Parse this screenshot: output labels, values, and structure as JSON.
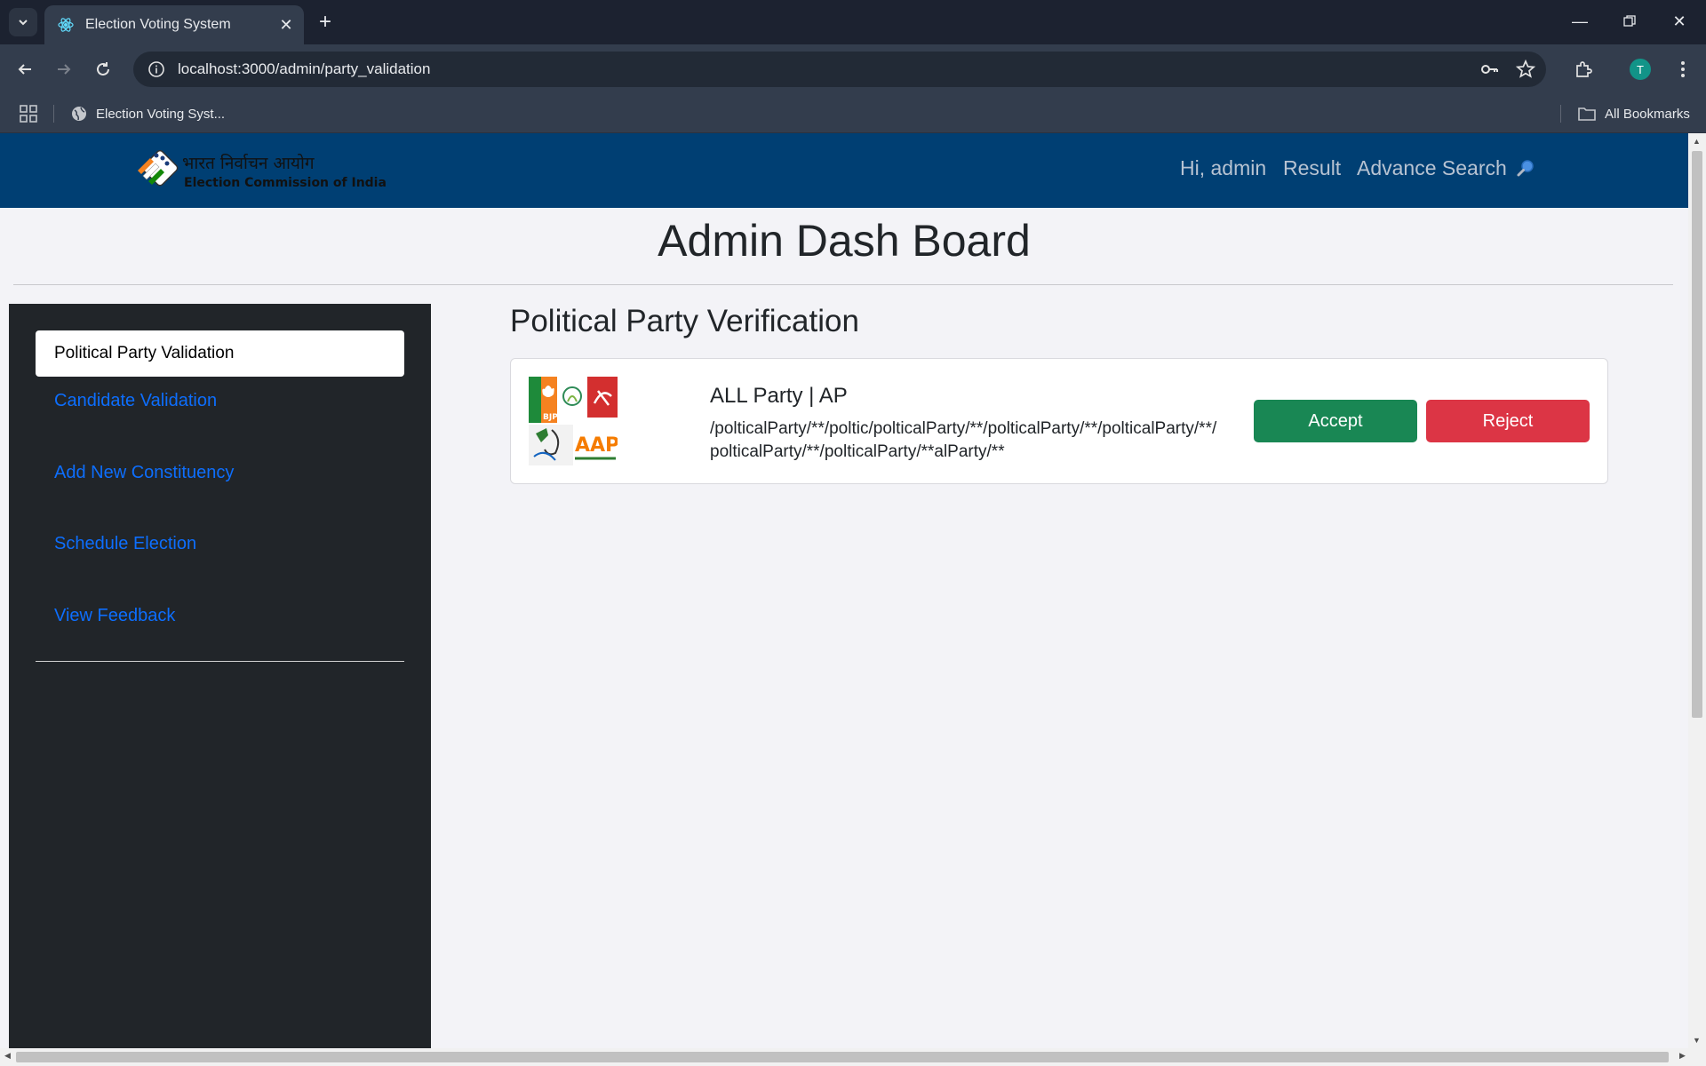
{
  "browser": {
    "tab_title": "Election Voting System",
    "url": "localhost:3000/admin/party_validation",
    "bookmark_item": "Election Voting Syst...",
    "all_bookmarks": "All Bookmarks",
    "profile_initial": "T"
  },
  "header": {
    "logo_hindi": "भारत निर्वाचन आयोग",
    "logo_english": "Election Commission of India",
    "nav": {
      "greeting": "Hi, admin",
      "result": "Result",
      "advance_search": "Advance Search"
    }
  },
  "page": {
    "title": "Admin Dash Board"
  },
  "sidebar": {
    "items": [
      {
        "label": "Political Party Validation",
        "active": true
      },
      {
        "label": "Candidate Validation",
        "active": false
      },
      {
        "label": "Add New Constituency",
        "active": false
      },
      {
        "label": "Schedule Election",
        "active": false
      },
      {
        "label": "View Feedback",
        "active": false
      }
    ]
  },
  "main": {
    "section_title": "Political Party Verification",
    "party": {
      "name": "ALL Party | AP",
      "path": "/polticalParty/**/poltic/polticalParty/**/polticalParty/**/polticalParty/**/polticalParty/**/polticalParty/**alParty/**",
      "accept_label": "Accept",
      "reject_label": "Reject"
    }
  },
  "colors": {
    "header_bg": "#003f73",
    "sidebar_bg": "#212529",
    "accept": "#198754",
    "reject": "#dc3545",
    "link": "#0d6efd"
  }
}
